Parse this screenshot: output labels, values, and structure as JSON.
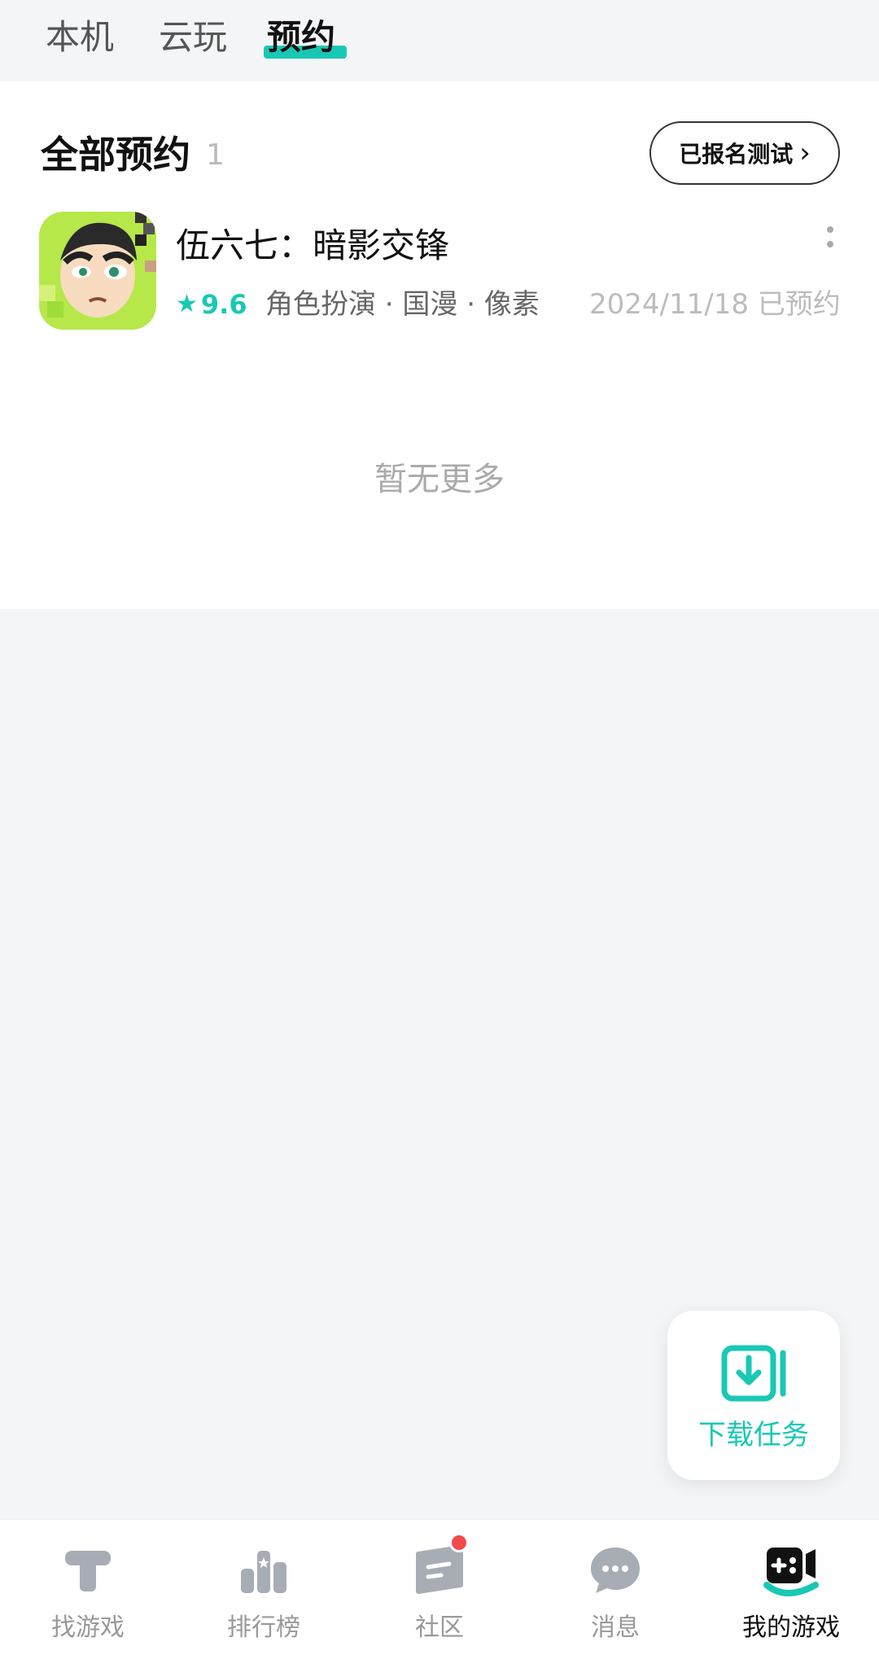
{
  "top_tabs": [
    {
      "label": "本机"
    },
    {
      "label": "云玩"
    },
    {
      "label": "预约",
      "active": true
    }
  ],
  "section": {
    "title": "全部预约",
    "count": "1",
    "signup_button": "已报名测试"
  },
  "game": {
    "name": "伍六七：暗影交锋",
    "rating": "9.6",
    "tags": "角色扮演 · 国漫 · 像素",
    "status": "2024/11/18 已预约"
  },
  "empty_text": "暂无更多",
  "download_task": {
    "label": "下载任务"
  },
  "bottom_nav": [
    {
      "label": "找游戏",
      "icon": "find-games-icon"
    },
    {
      "label": "排行榜",
      "icon": "leaderboard-icon"
    },
    {
      "label": "社区",
      "icon": "community-icon",
      "has_badge": true
    },
    {
      "label": "消息",
      "icon": "message-icon"
    },
    {
      "label": "我的游戏",
      "icon": "my-games-icon",
      "active": true
    }
  ],
  "colors": {
    "accent": "#19c8b4",
    "badge": "#f04a4a",
    "background": "#f4f5f7"
  }
}
